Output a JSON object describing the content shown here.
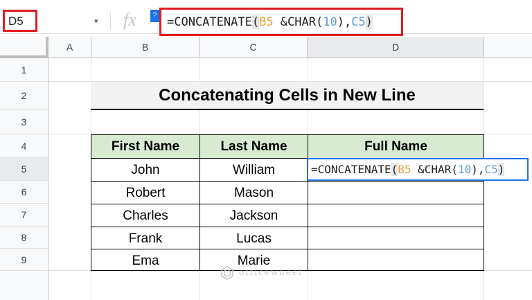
{
  "formula_bar": {
    "cell_reference": "D5",
    "dropdown_glyph": "▾",
    "fx_label": "fx",
    "help_glyph": "?",
    "formula_prefix": "=CONCATENATE",
    "formula_open": "(",
    "formula_ref1": "B5",
    "formula_mid": " &CHAR(",
    "formula_num": "10",
    "formula_close_char": "),",
    "formula_ref2": "C5",
    "formula_close": ")"
  },
  "columns": [
    "A",
    "B",
    "C",
    "D"
  ],
  "rows": [
    "1",
    "2",
    "3",
    "4",
    "5",
    "6",
    "7",
    "8",
    "9"
  ],
  "title": "Concatenating Cells in New Line",
  "table": {
    "headers": [
      "First Name",
      "Last Name",
      "Full Name"
    ],
    "rows": [
      [
        "John",
        "William",
        ""
      ],
      [
        "Robert",
        "Mason",
        ""
      ],
      [
        "Charles",
        "Jackson",
        ""
      ],
      [
        "Frank",
        "Lucas",
        ""
      ],
      [
        "Ema",
        "Marie",
        ""
      ]
    ]
  },
  "watermark": "officewheel",
  "colors": {
    "highlight_red": "#e31b23",
    "header_green": "#d9ead3",
    "selection_blue": "#1a73e8",
    "ref_orange": "#e8a13f",
    "ref_blue": "#5b9bd5"
  }
}
